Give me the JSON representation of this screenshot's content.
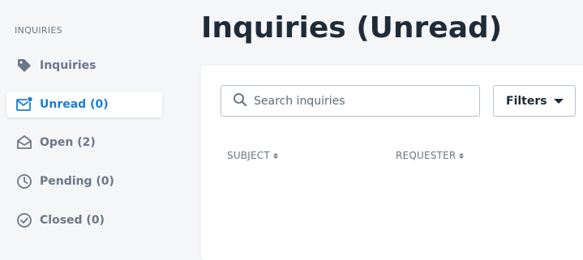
{
  "sidebar": {
    "section_label": "INQUIRIES",
    "items": [
      {
        "label": "Inquiries",
        "icon": "tag-icon"
      },
      {
        "label": "Unread (0)",
        "icon": "mail-unread-icon",
        "active": true
      },
      {
        "label": "Open (2)",
        "icon": "mail-open-icon"
      },
      {
        "label": "Pending (0)",
        "icon": "clock-icon"
      },
      {
        "label": "Closed (0)",
        "icon": "check-circle-icon"
      }
    ]
  },
  "main": {
    "title": "Inquiries (Unread)",
    "search": {
      "placeholder": "Search inquiries",
      "value": ""
    },
    "filters_label": "Filters",
    "columns": [
      "SUBJECT",
      "REQUESTER"
    ]
  },
  "colors": {
    "accent": "#1a7ed6",
    "muted": "#6b7785",
    "heading": "#1f2b37",
    "background": "#f5f6f8"
  }
}
